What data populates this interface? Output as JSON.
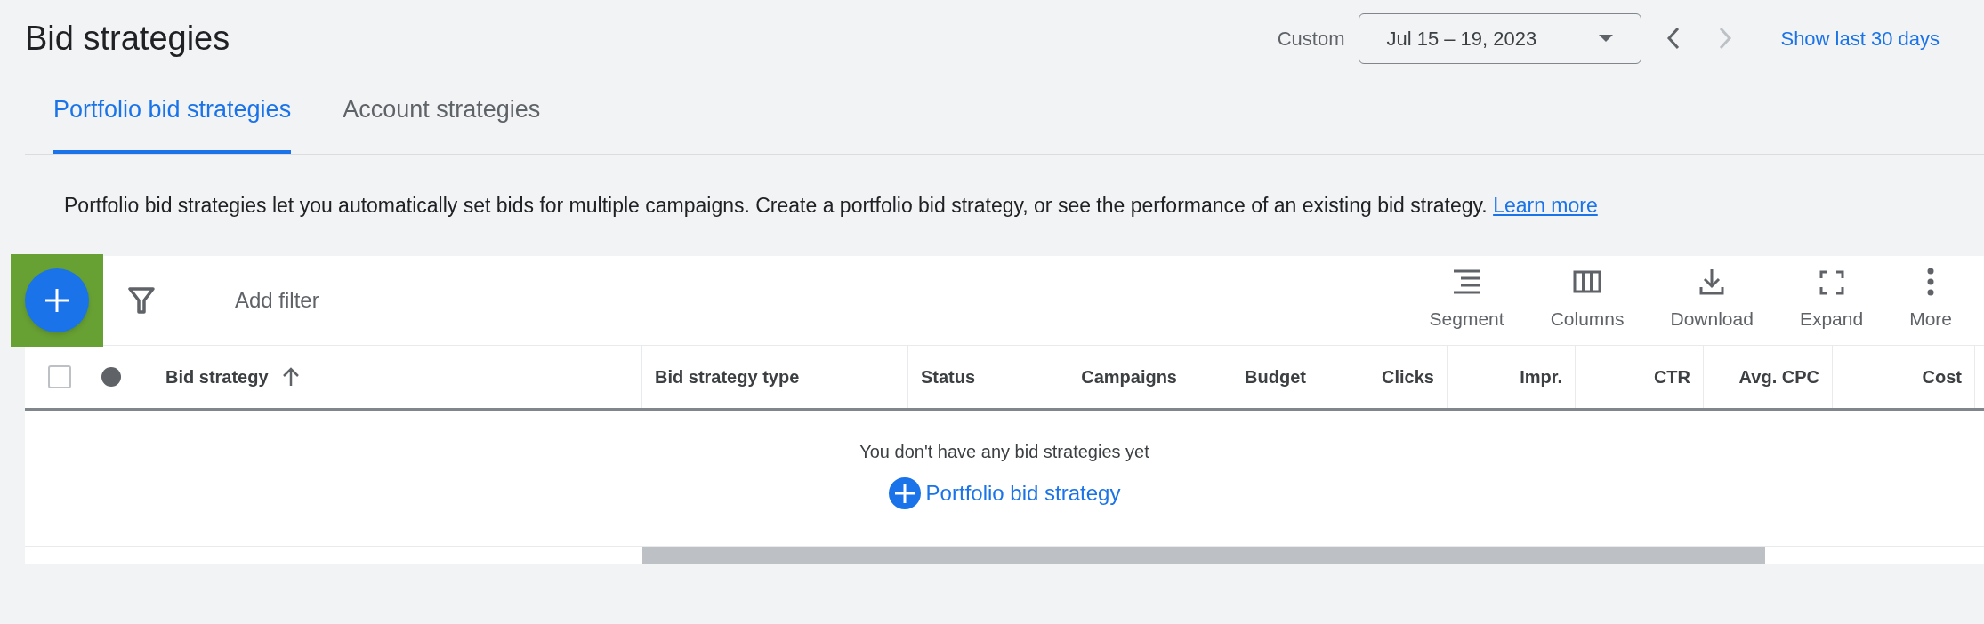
{
  "page_title": "Bid strategies",
  "date_range": {
    "label": "Custom",
    "value": "Jul 15 – 19, 2023",
    "nav": [
      {
        "kind": "prev",
        "disabled": false
      },
      {
        "kind": "next",
        "disabled": true
      }
    ],
    "link": "Show last 30 days"
  },
  "tabs": [
    {
      "label": "Portfolio bid strategies",
      "selected": true
    },
    {
      "label": "Account strategies",
      "selected": false
    }
  ],
  "description": {
    "text": "Portfolio bid strategies let you automatically set bids for multiple campaigns. Create a portfolio bid strategy, or see the performance of an existing bid strategy.",
    "link": "Learn more"
  },
  "toolbar": {
    "add_button": {
      "highlighted": true
    },
    "filter_placeholder": "Add filter",
    "actions": [
      {
        "kind": "segment",
        "label": "Segment"
      },
      {
        "kind": "columns",
        "label": "Columns"
      },
      {
        "kind": "download",
        "label": "Download"
      },
      {
        "kind": "expand",
        "label": "Expand"
      },
      {
        "kind": "more",
        "label": "More"
      }
    ]
  },
  "table": {
    "select_all_checked": false,
    "columns": [
      {
        "label": "Bid strategy",
        "sorted": true
      },
      {
        "label": "Bid strategy type",
        "sorted": false
      },
      {
        "label": "Status",
        "sorted": false
      },
      {
        "label": "Campaigns",
        "sorted": false
      },
      {
        "label": "Budget",
        "sorted": false
      },
      {
        "label": "Clicks",
        "sorted": false
      },
      {
        "label": "Impr.",
        "sorted": false
      },
      {
        "label": "CTR",
        "sorted": false
      },
      {
        "label": "Avg. CPC",
        "sorted": false
      },
      {
        "label": "Cost",
        "sorted": false
      }
    ],
    "empty_message": "You don't have any bid strategies yet",
    "empty_action": "Portfolio bid strategy"
  }
}
